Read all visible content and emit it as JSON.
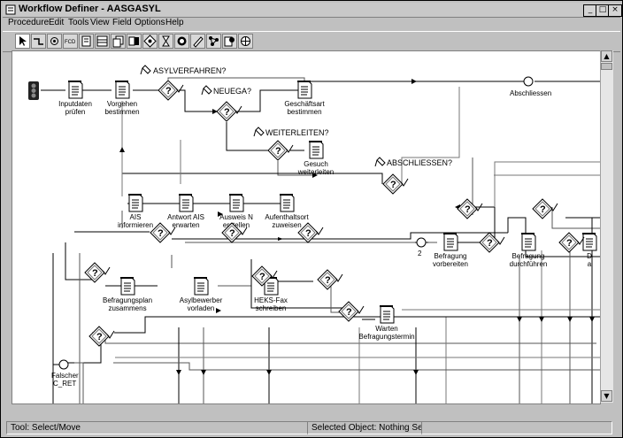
{
  "window": {
    "title": "Workflow Definer - AASGASYL",
    "min_glyph": "_",
    "max_glyph": "□",
    "close_glyph": "×"
  },
  "menu": [
    "Procedure",
    "Edit",
    "Tools",
    "View",
    "Field",
    "Options",
    "Help"
  ],
  "status": {
    "tool": "Tool: Select/Move",
    "selection": "Selected Object: Nothing Selected"
  },
  "scroll": {
    "up": "▲",
    "down": "▼"
  },
  "diagram": {
    "conditions": [
      "ASYLVERFAHREN?",
      "NEUEGA?",
      "WEITERLEITEN?",
      "ABSCHLIESSEN?"
    ],
    "tasks": [
      {
        "name": "task-inputdaten-pruefen",
        "l1": "Inputdaten",
        "l2": "prüfen"
      },
      {
        "name": "task-vorgehen-bestimmen",
        "l1": "Vorgehen",
        "l2": "bestimmen"
      },
      {
        "name": "task-geschaeftsart-bestimmen",
        "l1": "Geschäftsart",
        "l2": "bestimmen"
      },
      {
        "name": "task-gesuch-weiterleiten",
        "l1": "Gesuch",
        "l2": "weiterleiten"
      },
      {
        "name": "task-ais-informieren",
        "l1": "AIS",
        "l2": "informieren"
      },
      {
        "name": "task-antwort-ais-erwarten",
        "l1": "Antwort AIS",
        "l2": "erwarten"
      },
      {
        "name": "task-ausweis-n-erstellen",
        "l1": "Ausweis N",
        "l2": "erstellen"
      },
      {
        "name": "task-aufenthaltsort-zuweisen",
        "l1": "Aufenthaltsort",
        "l2": "zuweisen"
      },
      {
        "name": "task-befragung-vorbereiten",
        "l1": "Befragung",
        "l2": "vorbereiten"
      },
      {
        "name": "task-befragung-durchfuehren",
        "l1": "Befragung",
        "l2": "durchführen"
      },
      {
        "name": "task-befragungsplan-zusammenstellen",
        "l1": "Befragungsplan",
        "l2": "zusammens"
      },
      {
        "name": "task-asylbewerber-vorladen",
        "l1": "Asylbewerber",
        "l2": "vorladen"
      },
      {
        "name": "task-heks-fax-schreiben",
        "l1": "HEKS-Fax",
        "l2": "schreiben"
      },
      {
        "name": "task-warten-befragungstermin",
        "l1": "Warten",
        "l2": "Befragungstermin"
      },
      {
        "name": "task-partial-right",
        "l1": "D",
        "l2": "a"
      }
    ],
    "labels": {
      "abschliessen": "Abschliessen",
      "falscher": "Falscher",
      "c_ret": "C_RET",
      "merge_count": "2"
    }
  }
}
